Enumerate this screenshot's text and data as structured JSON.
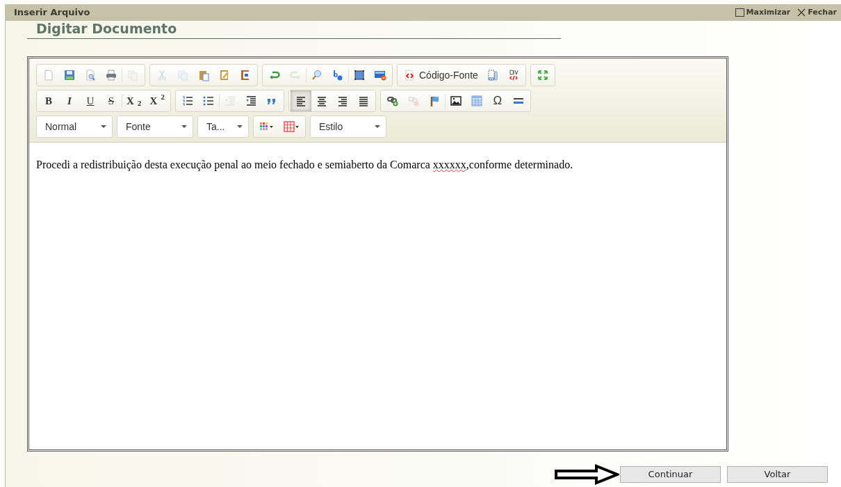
{
  "window": {
    "title": "Inserir Arquivo",
    "actions": [
      {
        "kind": "maximize",
        "label": "Maximizar"
      },
      {
        "kind": "close",
        "label": "Fechar"
      }
    ]
  },
  "heading": "Digitar Documento",
  "toolbar": {
    "rows": [
      {
        "groups": [
          {
            "items": [
              {
                "kind": "new",
                "disabled": false
              },
              {
                "kind": "save",
                "disabled": false
              },
              {
                "kind": "preview",
                "disabled": false
              },
              {
                "kind": "print",
                "disabled": false
              },
              {
                "kind": "sep"
              },
              {
                "kind": "templates",
                "disabled": true
              }
            ]
          },
          {
            "items": [
              {
                "kind": "cut",
                "disabled": true
              },
              {
                "kind": "copy",
                "disabled": true
              },
              {
                "kind": "paste",
                "disabled": false
              },
              {
                "kind": "pastetext",
                "disabled": false
              },
              {
                "kind": "pasteword",
                "disabled": false
              }
            ]
          },
          {
            "items": [
              {
                "kind": "undo",
                "disabled": false
              },
              {
                "kind": "redo",
                "disabled": true
              },
              {
                "kind": "sep"
              },
              {
                "kind": "find",
                "disabled": false
              },
              {
                "kind": "replace",
                "disabled": false
              },
              {
                "kind": "sep"
              },
              {
                "kind": "selectall",
                "disabled": false
              },
              {
                "kind": "removeformat",
                "disabled": false
              }
            ]
          },
          {
            "items": [
              {
                "kind": "source",
                "label": "Código-Fonte",
                "disabled": false
              },
              {
                "kind": "showblocks",
                "disabled": false
              },
              {
                "kind": "div",
                "disabled": false
              }
            ]
          },
          {
            "items": [
              {
                "kind": "maximize",
                "disabled": false
              }
            ]
          }
        ]
      },
      {
        "groups": [
          {
            "items": [
              {
                "kind": "glyph",
                "glyph": "B",
                "disabled": false
              },
              {
                "kind": "glyph",
                "glyph": "I",
                "disabled": false
              },
              {
                "kind": "glyph",
                "glyph": "U",
                "disabled": false
              },
              {
                "kind": "glyph",
                "glyph": "S",
                "disabled": false
              },
              {
                "kind": "sep"
              },
              {
                "kind": "glyph",
                "glyph": "X$_{2}$",
                "disabled": false
              },
              {
                "kind": "glyph",
                "glyph": "X$^{2}$",
                "disabled": false
              }
            ]
          },
          {
            "items": [
              {
                "kind": "ol",
                "disabled": false
              },
              {
                "kind": "ul",
                "disabled": false
              },
              {
                "kind": "sep"
              },
              {
                "kind": "outdent",
                "disabled": true
              },
              {
                "kind": "indent",
                "disabled": false
              },
              {
                "kind": "blockquote",
                "disabled": false
              }
            ]
          },
          {
            "items": [
              {
                "kind": "alignleft",
                "selected": true,
                "disabled": false
              },
              {
                "kind": "aligncenter",
                "selected": false,
                "disabled": false
              },
              {
                "kind": "alignright",
                "selected": false,
                "disabled": false
              },
              {
                "kind": "justify",
                "selected": false,
                "disabled": false
              }
            ]
          },
          {
            "items": [
              {
                "kind": "link",
                "disabled": false
              },
              {
                "kind": "unlink",
                "disabled": true
              },
              {
                "kind": "anchor",
                "disabled": false
              },
              {
                "kind": "sep"
              },
              {
                "kind": "image",
                "disabled": false
              },
              {
                "kind": "table",
                "disabled": false
              },
              {
                "kind": "glyph",
                "glyph": "Ω",
                "disabled": false
              },
              {
                "kind": "hr",
                "disabled": false
              }
            ]
          }
        ]
      },
      {
        "groups": [
          {
            "items": [
              {
                "kind": "combo",
                "label": "Normal"
              }
            ]
          },
          {
            "items": [
              {
                "kind": "combo",
                "label": "Fonte"
              }
            ]
          },
          {
            "items": [
              {
                "kind": "combo",
                "label": "Ta..."
              }
            ]
          },
          {
            "items": [
              {
                "kind": "textcolor"
              },
              {
                "kind": "bgcolor"
              }
            ]
          },
          {
            "items": [
              {
                "kind": "combo",
                "label": "Estilo"
              }
            ]
          }
        ]
      }
    ]
  },
  "content": [
    {
      "text": "Procedi a redistribuição desta execução penal ao meio fechado e semiaberto da Comarca ",
      "misspelled": false
    },
    {
      "text": "xxxxxx",
      "misspelled": true
    },
    {
      "text": ",conforme determinado.",
      "misspelled": false
    }
  ],
  "pointer_arrow": {
    "shown": true
  },
  "buttons": [
    {
      "label": "Continuar"
    },
    {
      "label": "Voltar"
    }
  ]
}
